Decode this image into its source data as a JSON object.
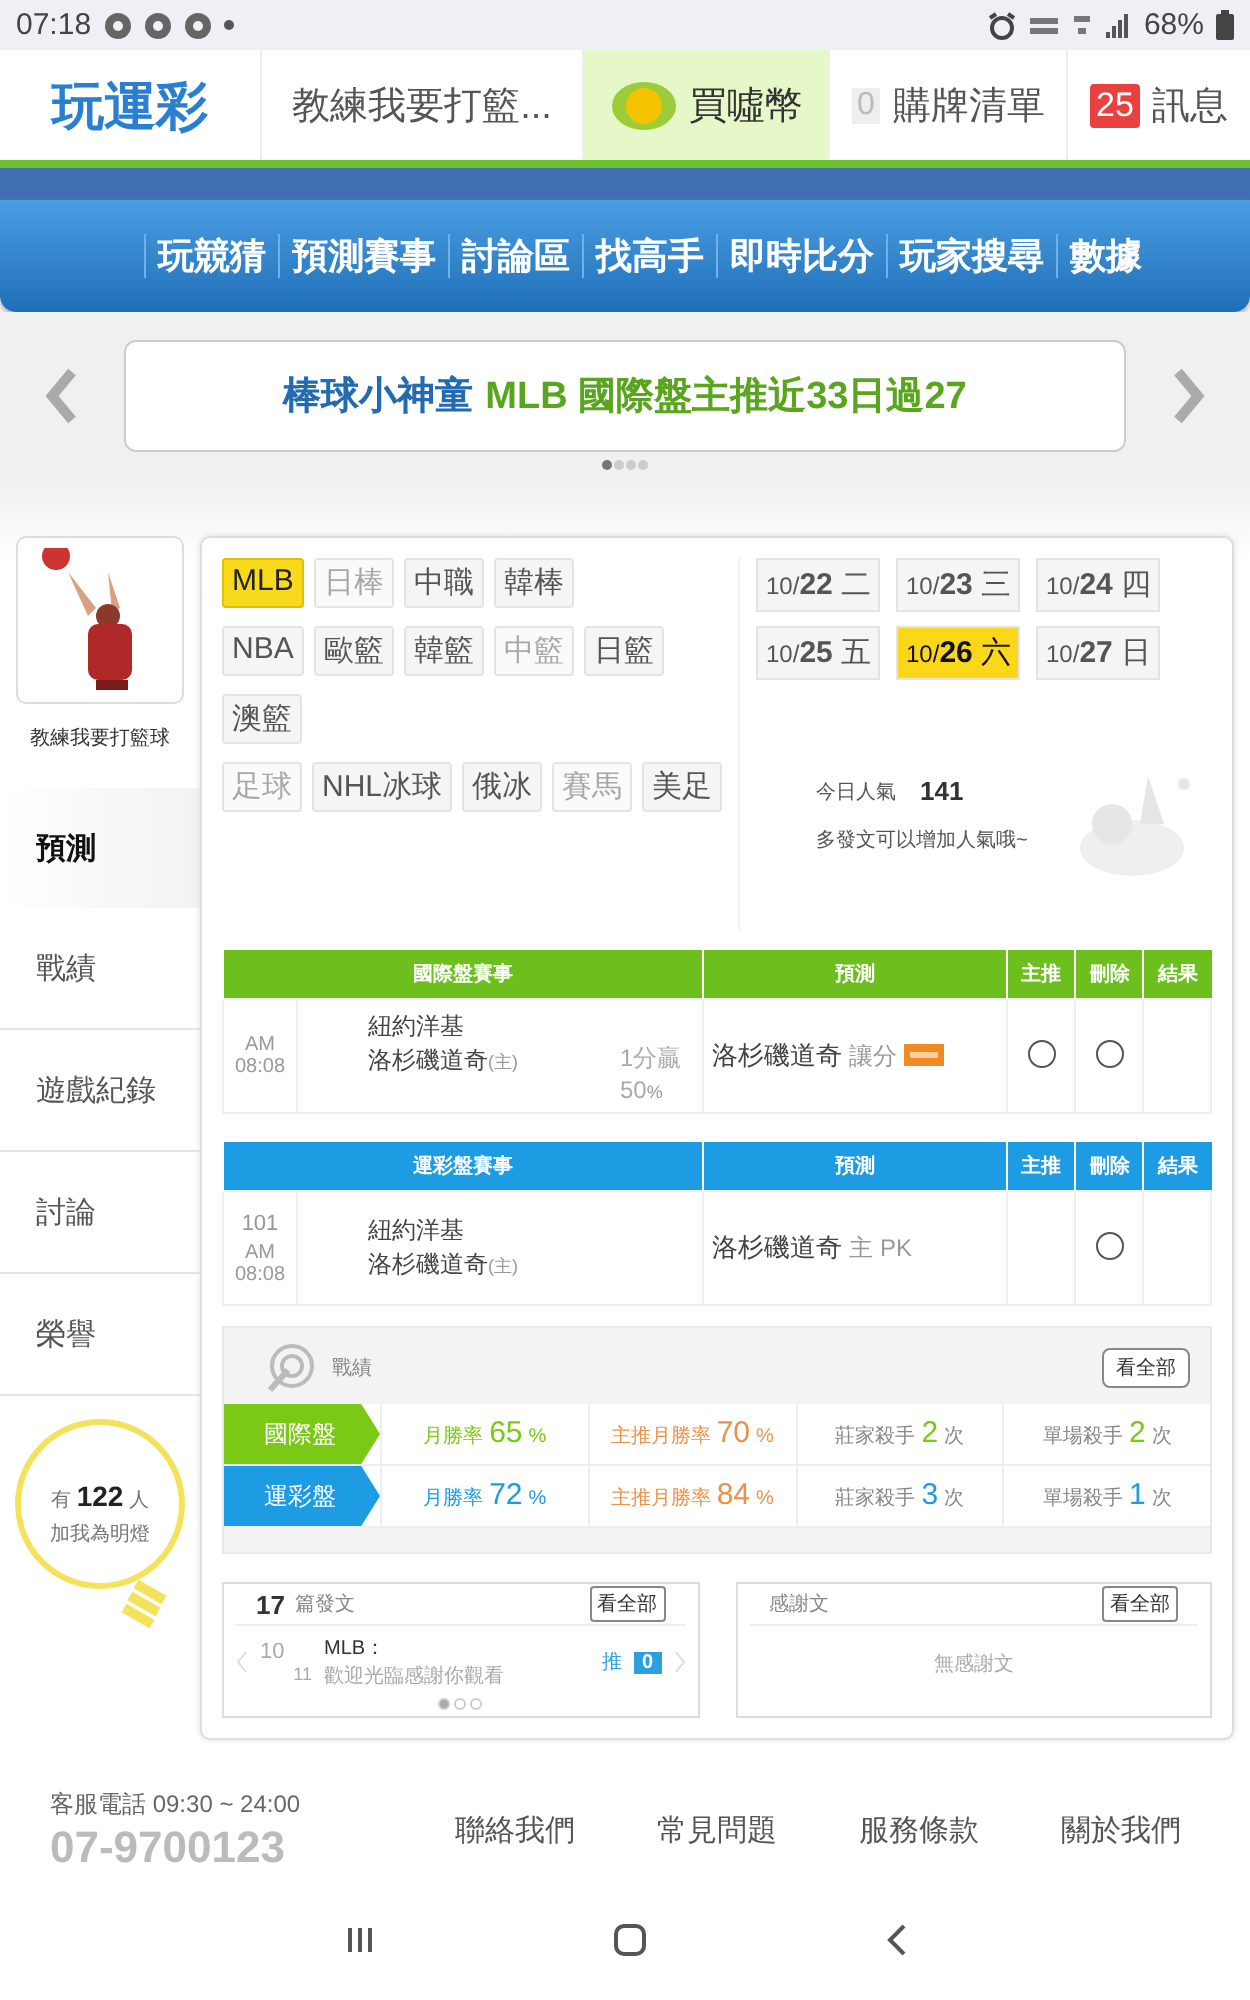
{
  "status_bar": {
    "time": "07:18",
    "battery": "68%"
  },
  "header": {
    "logo": "玩運彩",
    "user": "教練我要打籃...",
    "coin_label": "買噓幣",
    "cart_count": "0",
    "cart_label": "購牌清單",
    "message_count": "25",
    "message_label": "訊息"
  },
  "nav": [
    "玩競猜",
    "預測賽事",
    "討論區",
    "找高手",
    "即時比分",
    "玩家搜尋",
    "數據"
  ],
  "banner": {
    "name": "棒球小神童",
    "text": "MLB 國際盤主推近33日過27",
    "dots": [
      {
        "selected": true
      },
      {
        "selected": false
      },
      {
        "selected": false
      },
      {
        "selected": false
      }
    ]
  },
  "profile": {
    "name": "教練我要打籃球"
  },
  "sidebar_tabs": [
    {
      "label": "預測",
      "selected": true
    },
    {
      "label": "戰績",
      "selected": false
    },
    {
      "label": "遊戲紀錄",
      "selected": false
    },
    {
      "label": "討論",
      "selected": false
    },
    {
      "label": "榮譽",
      "selected": false
    }
  ],
  "fans": {
    "prefix": "有",
    "count": "122",
    "suffix": "人",
    "caption": "加我為明燈"
  },
  "sports": [
    [
      {
        "label": "MLB",
        "selected": true,
        "disabled": false
      },
      {
        "label": "日棒",
        "selected": false,
        "disabled": true
      },
      {
        "label": "中職",
        "selected": false,
        "disabled": false
      },
      {
        "label": "韓棒",
        "selected": false,
        "disabled": false
      }
    ],
    [
      {
        "label": "NBA",
        "selected": false,
        "disabled": false
      },
      {
        "label": "歐籃",
        "selected": false,
        "disabled": false
      },
      {
        "label": "韓籃",
        "selected": false,
        "disabled": false
      },
      {
        "label": "中籃",
        "selected": false,
        "disabled": true
      },
      {
        "label": "日籃",
        "selected": false,
        "disabled": false
      }
    ],
    [
      {
        "label": "澳籃",
        "selected": false,
        "disabled": false
      }
    ],
    [
      {
        "label": "足球",
        "selected": false,
        "disabled": true
      },
      {
        "label": "NHL冰球",
        "selected": false,
        "disabled": false
      },
      {
        "label": "俄冰",
        "selected": false,
        "disabled": false
      },
      {
        "label": "賽馬",
        "selected": false,
        "disabled": true
      },
      {
        "label": "美足",
        "selected": false,
        "disabled": false
      }
    ]
  ],
  "dates": [
    {
      "month": "10/",
      "day": "22",
      "weekday": "二",
      "selected": false
    },
    {
      "month": "10/",
      "day": "23",
      "weekday": "三",
      "selected": false
    },
    {
      "month": "10/",
      "day": "24",
      "weekday": "四",
      "selected": false
    },
    {
      "month": "10/",
      "day": "25",
      "weekday": "五",
      "selected": false
    },
    {
      "month": "10/",
      "day": "26",
      "weekday": "六",
      "selected": true
    },
    {
      "month": "10/",
      "day": "27",
      "weekday": "日",
      "selected": false
    }
  ],
  "popularity": {
    "label": "今日人氣",
    "value": "141",
    "hint": "多發文可以增加人氣哦~"
  },
  "tables": [
    {
      "color": "#6cbf1c",
      "columns": [
        "國際盤賽事",
        "預測",
        "主推",
        "刪除",
        "結果"
      ],
      "rows": [
        {
          "time": "AM 08:08",
          "away": "紐約洋基",
          "home": "洛杉磯道奇",
          "home_mark": "(主)",
          "odds": "1分贏",
          "odds_pct": "50",
          "odds_unit": "%",
          "pick": "洛杉磯道奇",
          "pick_type": "讓分",
          "main": {
            "checked": false
          },
          "delete": {
            "checked": false
          }
        }
      ]
    },
    {
      "color": "#1d9be3",
      "columns": [
        "運彩盤賽事",
        "預測",
        "主推",
        "刪除",
        "結果"
      ],
      "rows": [
        {
          "no": "101",
          "time": "AM 08:08",
          "away": "紐約洋基",
          "home": "洛杉磯道奇",
          "home_mark": "(主)",
          "pick": "洛杉磯道奇",
          "pick_type": "主 PK",
          "delete": {
            "checked": false
          }
        }
      ]
    }
  ],
  "record": {
    "title": "戰績",
    "button": "看全部",
    "rows": [
      {
        "label": "國際盤",
        "color": "#7cc817",
        "cells": [
          {
            "kind": "rate",
            "label": "月勝率",
            "value": "65",
            "unit": "%"
          },
          {
            "kind": "main",
            "label": "主推月勝率",
            "value": "70",
            "unit": "%"
          },
          {
            "kind": "count",
            "label": "莊家殺手",
            "value": "2",
            "unit": "次"
          },
          {
            "kind": "count",
            "label": "單場殺手",
            "value": "2",
            "unit": "次"
          }
        ]
      },
      {
        "label": "運彩盤",
        "color": "#1d9be3",
        "cells": [
          {
            "kind": "rate",
            "label": "月勝率",
            "value": "72",
            "unit": "%"
          },
          {
            "kind": "main",
            "label": "主推月勝率",
            "value": "84",
            "unit": "%"
          },
          {
            "kind": "count",
            "label": "莊家殺手",
            "value": "3",
            "unit": "次"
          },
          {
            "kind": "count",
            "label": "單場殺手",
            "value": "1",
            "unit": "次"
          }
        ]
      }
    ]
  },
  "posts": {
    "count": "17",
    "label": "篇發文",
    "button": "看全部",
    "item": {
      "month": "10",
      "day": "11",
      "title": "MLB：",
      "text": "歡迎光臨感謝你觀看",
      "push_label": "推",
      "push_count": "0"
    },
    "dots": [
      {
        "selected": true
      },
      {
        "selected": false
      },
      {
        "selected": false
      }
    ]
  },
  "thanks": {
    "title": "感謝文",
    "button": "看全部",
    "empty": "無感謝文"
  },
  "footer": {
    "hours": "客服電話 09:30 ~ 24:00",
    "phone": "07-9700123",
    "links": [
      "聯絡我們",
      "常見問題",
      "服務條款",
      "關於我們"
    ]
  }
}
